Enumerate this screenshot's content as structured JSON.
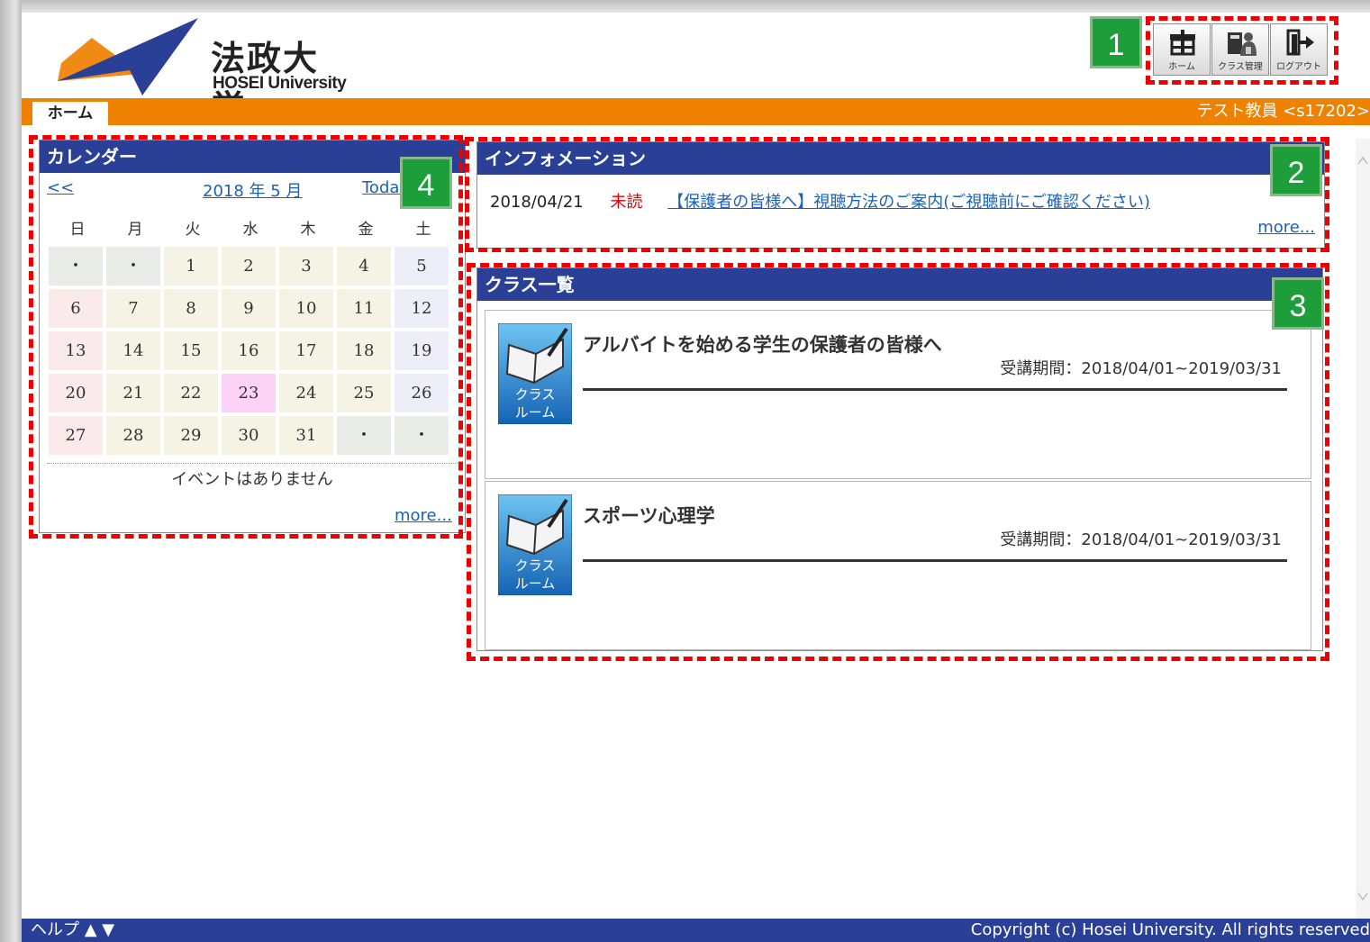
{
  "header": {
    "logo_kanji": "法政大学",
    "logo_en": "HOSEI University",
    "nav_icons": [
      {
        "label": "ホーム",
        "icon": "building-icon"
      },
      {
        "label": "クラス管理",
        "icon": "class-management-icon"
      },
      {
        "label": "ログアウト",
        "icon": "logout-door-icon"
      }
    ]
  },
  "navbar": {
    "tab_home": "ホーム",
    "user": "テスト教員 <s17202>"
  },
  "annotations": [
    "1",
    "2",
    "3",
    "4"
  ],
  "calendar": {
    "title": "カレンダー",
    "prev": "<<",
    "month": "2018 年 5 月",
    "today": "Today",
    "weekdays": [
      "日",
      "月",
      "火",
      "水",
      "木",
      "金",
      "土"
    ],
    "days": [
      "・",
      "・",
      "1",
      "2",
      "3",
      "4",
      "5",
      "6",
      "7",
      "8",
      "9",
      "10",
      "11",
      "12",
      "13",
      "14",
      "15",
      "16",
      "17",
      "18",
      "19",
      "20",
      "21",
      "22",
      "23",
      "24",
      "25",
      "26",
      "27",
      "28",
      "29",
      "30",
      "31",
      "・",
      "・"
    ],
    "highlight_day": "23",
    "events": "イベントはありません",
    "more": "more..."
  },
  "information": {
    "title": "インフォメーション",
    "date": "2018/04/21",
    "status": "未読",
    "link": "【保護者の皆様へ】視聴方法のご案内(ご視聴前にご確認ください)",
    "more": "more..."
  },
  "classes": {
    "title": "クラス一覧",
    "icon_label_1": "クラス",
    "icon_label_2": "ルーム",
    "items": [
      {
        "name": "アルバイトを始める学生の保護者の皆様へ",
        "period": "受講期間：2018/04/01~2019/03/31"
      },
      {
        "name": "スポーツ心理学",
        "period": "受講期間：2018/04/01~2019/03/31"
      }
    ]
  },
  "footer": {
    "help": "ヘルプ ▲ ▼",
    "copyright": "Copyright (c) Hosei University. All rights reserved"
  },
  "colors": {
    "orange": "#ee8200",
    "navy": "#2a3f96",
    "annotation_green": "#1e9e3a",
    "annotation_red": "#ee0000",
    "link": "#1a62b8"
  }
}
